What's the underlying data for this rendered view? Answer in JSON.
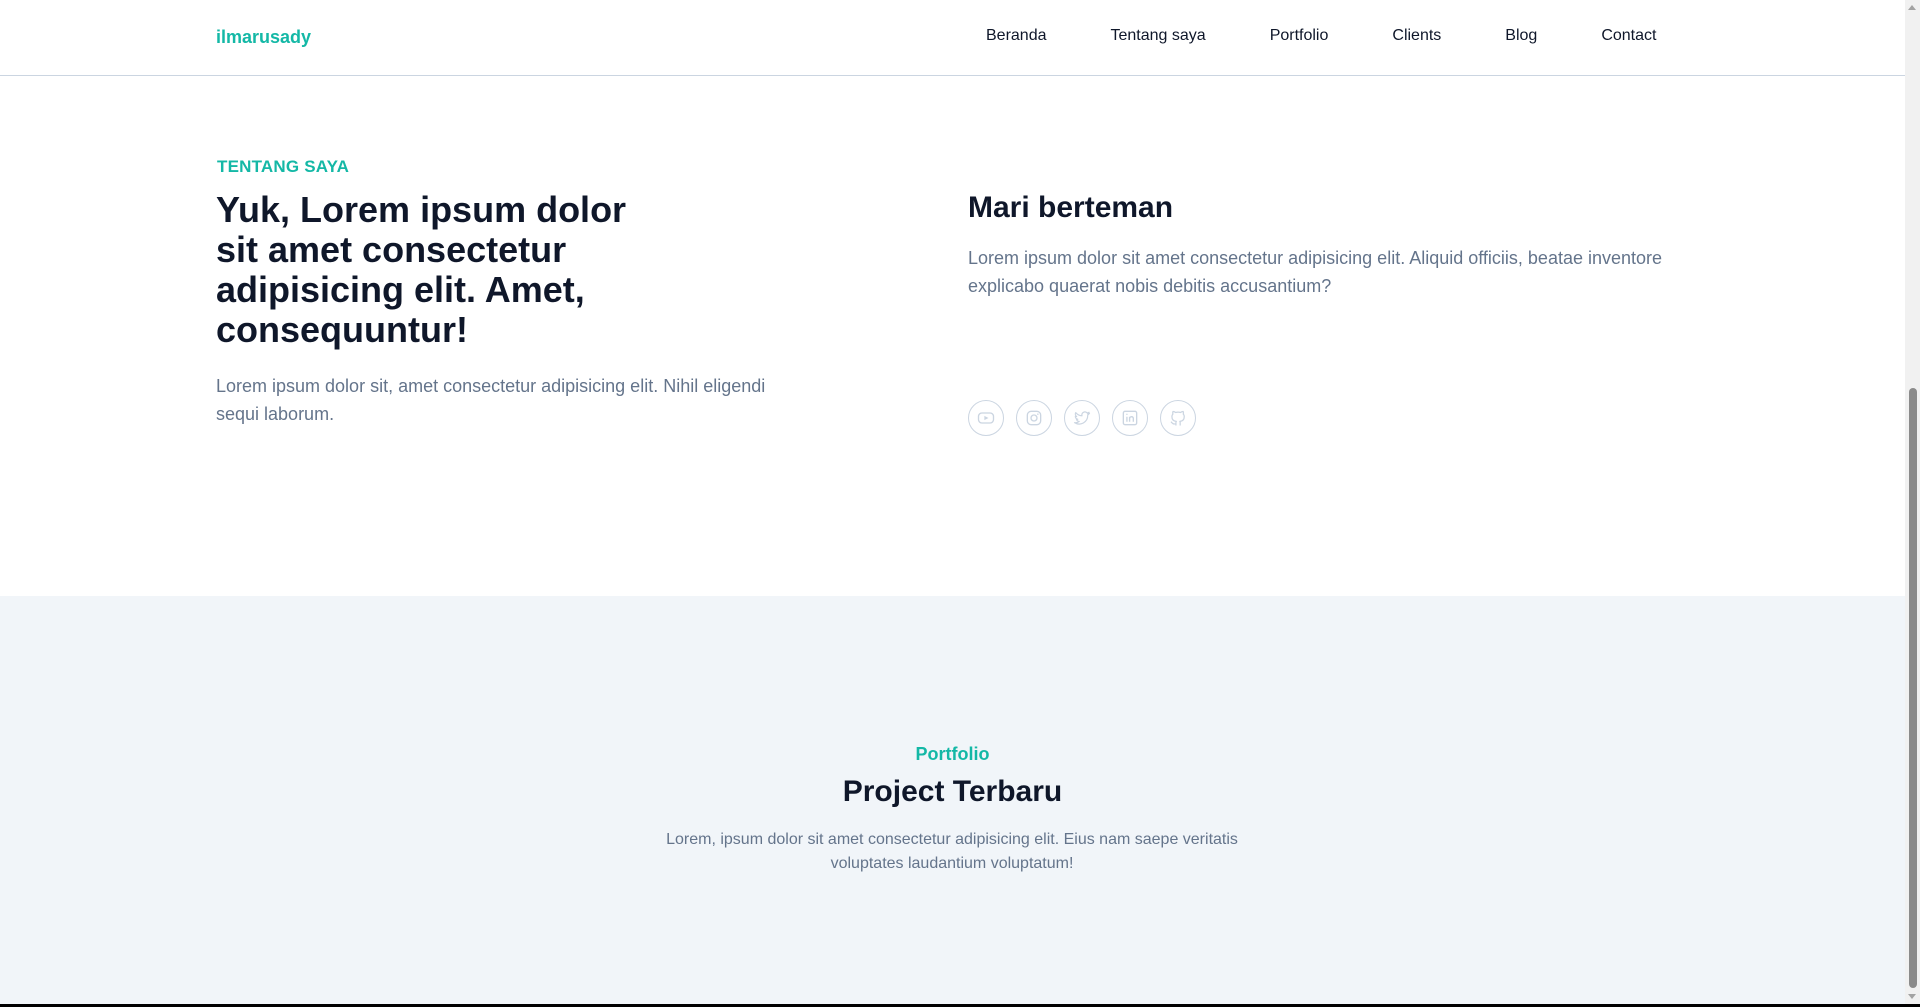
{
  "header": {
    "logo": "ilmarusady",
    "nav": [
      "Beranda",
      "Tentang saya",
      "Portfolio",
      "Clients",
      "Blog",
      "Contact"
    ]
  },
  "about": {
    "eyebrow": "TENTANG SAYA",
    "title": "Yuk, Lorem ipsum dolor sit amet consectetur adipisicing elit. Amet, consequuntur!",
    "description": "Lorem ipsum dolor sit, amet consectetur adipisicing elit. Nihil eligendi sequi laborum.",
    "friend_title": "Mari berteman",
    "friend_description": "Lorem ipsum dolor sit amet consectetur adipisicing elit. Aliquid officiis, beatae inventore explicabo quaerat nobis debitis accusantium?",
    "socials": [
      "youtube-icon",
      "instagram-icon",
      "twitter-icon",
      "linkedin-icon",
      "github-icon"
    ]
  },
  "portfolio": {
    "eyebrow": "Portfolio",
    "title": "Project Terbaru",
    "description": "Lorem, ipsum dolor sit amet consectetur adipisicing elit. Eius nam saepe veritatis voluptates laudantium voluptatum!"
  },
  "colors": {
    "accent": "#14b8a6",
    "heading": "#0f172a",
    "body_text": "#64748b",
    "section_bg": "#f1f5f9"
  }
}
